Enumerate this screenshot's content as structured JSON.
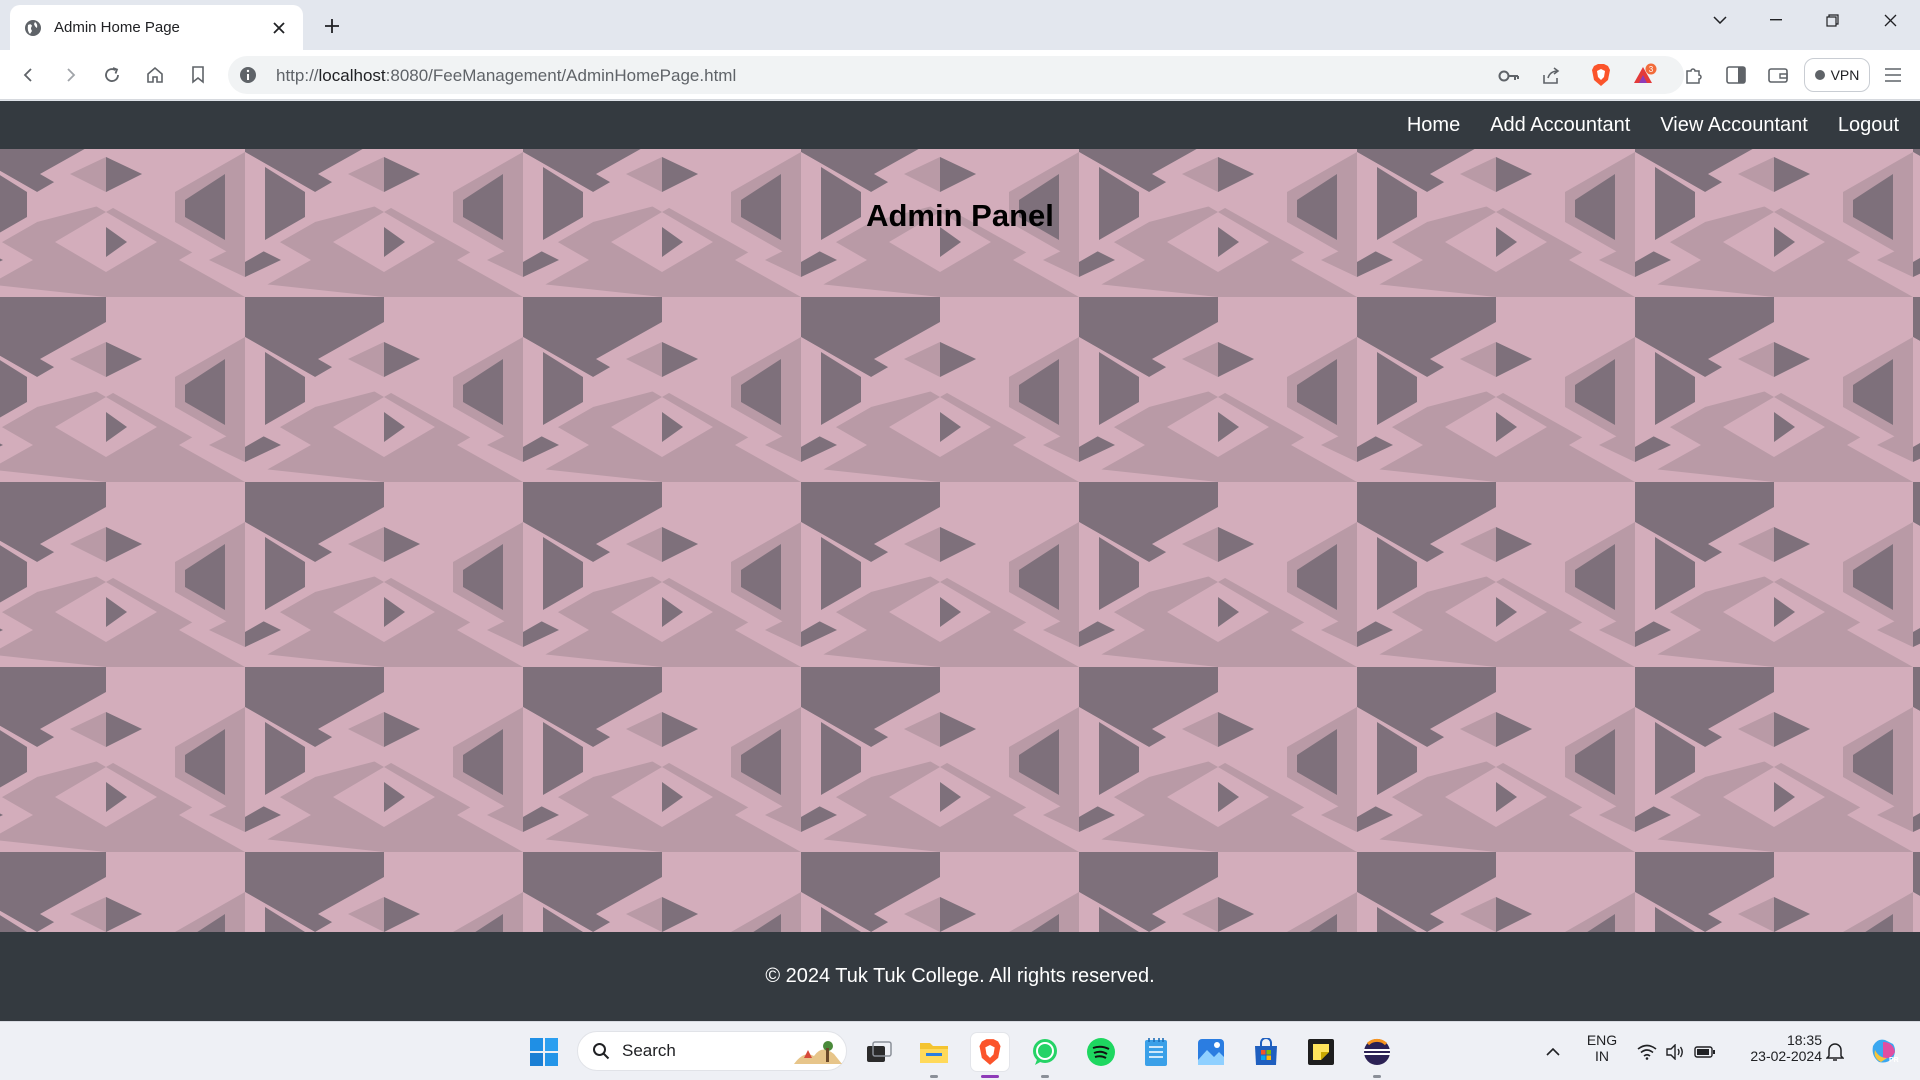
{
  "browser": {
    "tab_title": "Admin Home Page",
    "url_scheme": "http://",
    "url_host": "localhost",
    "url_rest": ":8080/FeeManagement/AdminHomePage.html",
    "vpn_label": "VPN",
    "alert_badge_count": "3"
  },
  "site": {
    "nav": {
      "home": "Home",
      "add_accountant": "Add Accountant",
      "view_accountant": "View Accountant",
      "logout": "Logout"
    },
    "hero_title": "Admin Panel",
    "footer_text": "© 2024 Tuk Tuk College. All rights reserved."
  },
  "taskbar": {
    "search_label": "Search",
    "language_line1": "ENG",
    "language_line2": "IN",
    "time": "18:35",
    "date": "23-02-2024",
    "apps": [
      "start",
      "search",
      "task-view",
      "file-explorer",
      "brave",
      "whatsapp",
      "spotify",
      "notepad",
      "photos",
      "microsoft-store",
      "sticky-notes",
      "eclipse"
    ]
  },
  "colors": {
    "navbar_bg": "#343a40",
    "pattern_light": "#d3adbb",
    "pattern_mid": "#b99aa6",
    "pattern_dark": "#7e707b",
    "brave_orange": "#fb542b"
  }
}
